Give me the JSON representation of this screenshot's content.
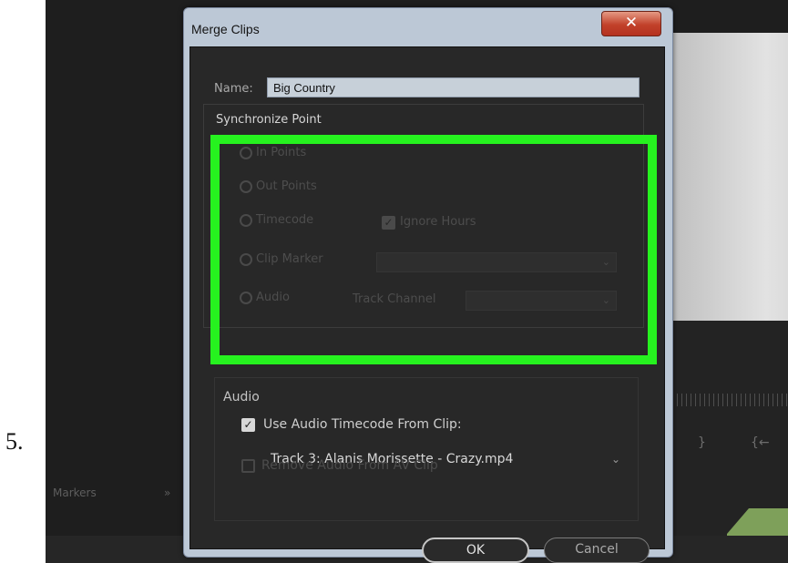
{
  "step_number": "5.",
  "dialog": {
    "title": "Merge Clips",
    "close_glyph": "✕",
    "name_label": "Name:",
    "name_value": "Big Country",
    "sync_title": "Synchronize Point",
    "options": {
      "in_points": "In Points",
      "out_points": "Out Points",
      "timecode": "Timecode",
      "ignore_hours": "Ignore Hours",
      "clip_marker": "Clip Marker",
      "audio": "Audio",
      "track_channel": "Track Channel"
    },
    "audio_section": {
      "title": "Audio",
      "use_audio_timecode": "Use Audio Timecode From Clip:",
      "track_value": "Track 3: Alanis Morissette - Crazy.mp4",
      "remove_audio": "Remove Audio From AV Clip"
    },
    "ok_label": "OK",
    "cancel_label": "Cancel"
  },
  "background": {
    "markers_label": "Markers",
    "panel_arrows": "»"
  },
  "colors": {
    "highlight": "#26f21f",
    "dialog_frame": "#bcc8d6",
    "dialog_body": "#282828",
    "close_button": "#c2412a"
  }
}
